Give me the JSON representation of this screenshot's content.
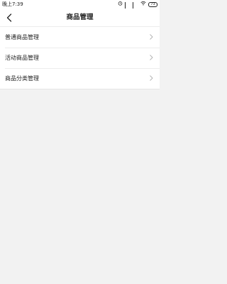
{
  "status_bar": {
    "time": "晚上7:39",
    "battery": "73"
  },
  "nav": {
    "title": "商品管理"
  },
  "menu": {
    "items": [
      {
        "label": "普通商品管理"
      },
      {
        "label": "活动商品管理"
      },
      {
        "label": "商品分类管理"
      }
    ]
  }
}
